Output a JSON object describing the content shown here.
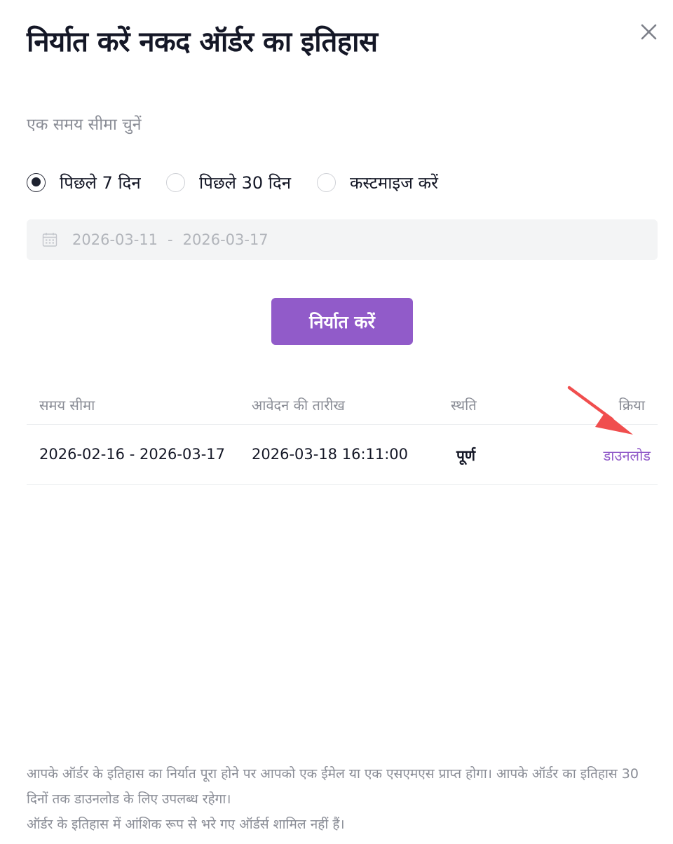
{
  "dialog": {
    "title": "निर्यात करें नकद ऑर्डर का इतिहास",
    "close_icon": "close-icon"
  },
  "range": {
    "label": "एक समय सीमा चुनें",
    "options": [
      {
        "label": "पिछले 7 दिन",
        "checked": true
      },
      {
        "label": "पिछले 30 दिन",
        "checked": false
      },
      {
        "label": "कस्टमाइज करें",
        "checked": false
      }
    ],
    "date_start": "2026-03-11",
    "date_separator": "-",
    "date_end": "2026-03-17",
    "calendar_icon": "calendar-icon"
  },
  "export_button": {
    "label": "निर्यात करें",
    "color": "#915bc9"
  },
  "table": {
    "headers": [
      "समय सीमा",
      "आवेदन की तारीख",
      "स्थति",
      "क्रिया"
    ],
    "rows": [
      {
        "range": "2026-02-16 - 2026-03-17",
        "applied": "2026-03-18 16:11:00",
        "status": "पूर्ण",
        "action": "डाउनलोड"
      }
    ]
  },
  "annotation": {
    "arrow_color": "#f04e4e"
  },
  "footnote": {
    "line1": "आपके ऑर्डर के इतिहास का निर्यात पूरा होने पर आपको एक ईमेल या एक एसएमएस प्राप्त होगा। आपके ऑर्डर का इतिहास 30 दिनों तक डाउनलोड के लिए उपलब्ध रहेगा।",
    "line2": "ऑर्डर के इतिहास में आंशिक रूप से भरे गए ऑर्डर्स शामिल नहीं हैं।"
  }
}
